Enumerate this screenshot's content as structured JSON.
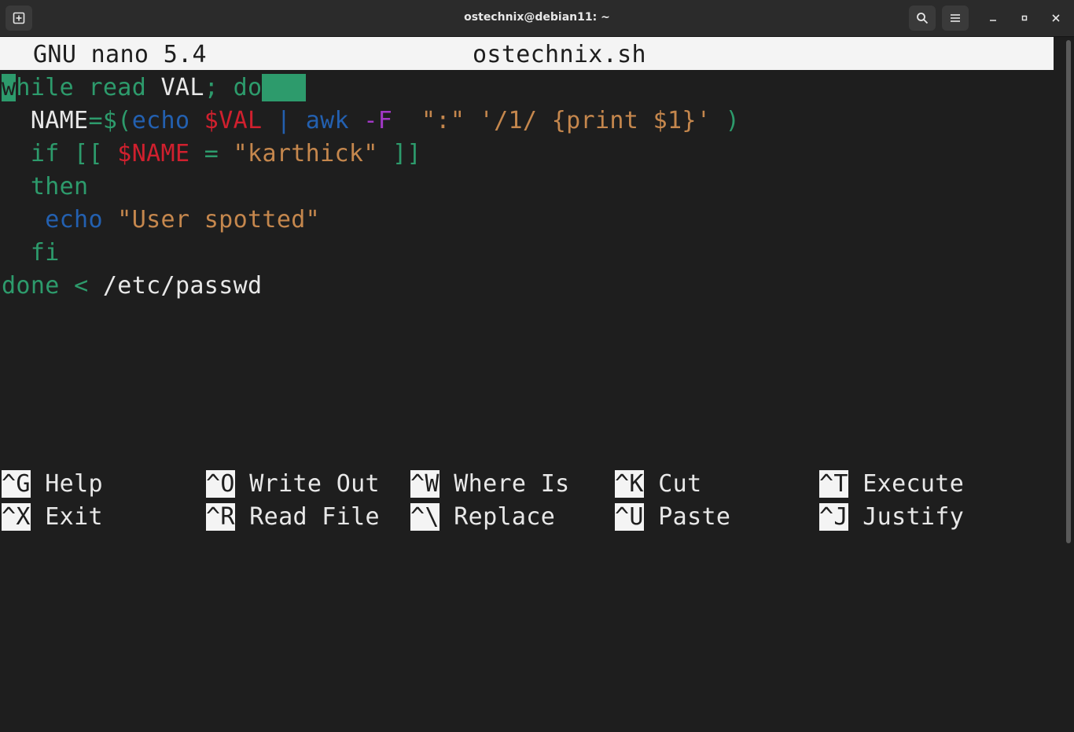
{
  "window": {
    "title": "ostechnix@debian11: ~",
    "icons": [
      "new-tab-icon",
      "search-icon",
      "hamburger-menu-icon",
      "minimize-icon",
      "maximize-icon",
      "close-icon"
    ]
  },
  "nano": {
    "header_app": "GNU nano 5.4",
    "header_file": "ostechnix.sh"
  },
  "code": {
    "l1_w": "w",
    "l1_rest": "hile read",
    "l1_var": " VAL",
    "l1_semi": ";",
    "l1_do": " do",
    "l2_indent": "  NAME",
    "l2_eq": "=$(",
    "l2_echo": "echo",
    "l2_var": " $VAL",
    "l2_pipe": " |",
    "l2_awk": " awk",
    "l2_flag": " -F",
    "l2_str": "  \":\" '/1/ {print $1}'",
    "l2_close": " )",
    "l3_if": "  if [[",
    "l3_var": " $NAME",
    "l3_eq": " =",
    "l3_str": " \"karthick\"",
    "l3_close": " ]]",
    "l4": "  then",
    "l5_echo": "   echo",
    "l5_str": " \"User spotted\"",
    "l6": "  fi",
    "l7_done": "done",
    "l7_lt": " <",
    "l7_path": " /etc/passwd"
  },
  "shortcuts": [
    {
      "key": "^G",
      "label": "Help"
    },
    {
      "key": "^O",
      "label": "Write Out"
    },
    {
      "key": "^W",
      "label": "Where Is"
    },
    {
      "key": "^K",
      "label": "Cut"
    },
    {
      "key": "^T",
      "label": "Execute"
    },
    {
      "key": "^X",
      "label": "Exit"
    },
    {
      "key": "^R",
      "label": "Read File"
    },
    {
      "key": "^\\",
      "label": "Replace"
    },
    {
      "key": "^U",
      "label": "Paste"
    },
    {
      "key": "^J",
      "label": "Justify"
    }
  ]
}
